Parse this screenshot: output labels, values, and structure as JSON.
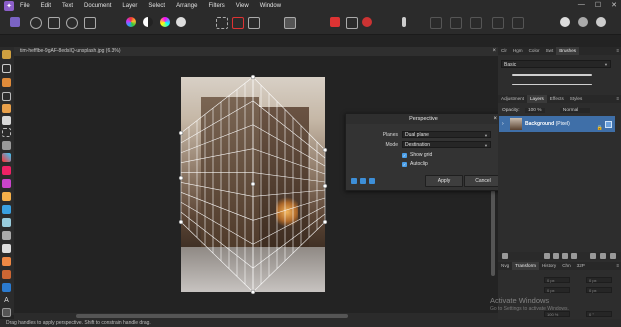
{
  "app": {
    "menus": [
      "File",
      "Edit",
      "Text",
      "Document",
      "Layer",
      "Select",
      "Arrange",
      "Filters",
      "View",
      "Window"
    ],
    "window_buttons": [
      "—",
      "☐",
      "✕"
    ]
  },
  "document": {
    "tab_title": "tim-hefflbe-9gAF-8edsIQ-unsplash.jpg (6.3%)"
  },
  "dialog": {
    "title": "Perspective",
    "planes_label": "Planes",
    "planes_value": "Dual plane",
    "mode_label": "Mode",
    "mode_value": "Destination",
    "show_grid_label": "Show grid",
    "show_grid_checked": true,
    "autoclip_label": "Autoclip",
    "autoclip_checked": true,
    "apply_label": "Apply",
    "cancel_label": "Cancel"
  },
  "right_panel": {
    "top_tabs": [
      "Clr",
      "Hgm",
      "Color",
      "Swt",
      "Brushes"
    ],
    "top_active": "Brushes",
    "brush_category": "Basic",
    "mid_tabs": [
      "Adjustment",
      "Layers",
      "Effects",
      "Styles"
    ],
    "mid_active": "Layers",
    "opacity_label": "Opacity:",
    "opacity_value": "100 %",
    "blend_mode": "Normal",
    "layer_name": "Background",
    "layer_type": "(Pixel)",
    "bottom_tabs": [
      "Nvg",
      "Transform",
      "History",
      "Chn",
      "32P"
    ],
    "bottom_active": "Transform",
    "transform_fields": [
      "0 px",
      "0 px",
      "0 px",
      "0 px",
      "100 %",
      "0 °"
    ]
  },
  "status_bar": {
    "text": "Drag handles to apply perspective. Shift to constrain handle drag."
  },
  "watermark": {
    "line1": "Activate Windows",
    "line2": "Go to Settings to activate Windows."
  },
  "colors": {
    "accent": "#4a9ee8",
    "layer_selected": "#3f6fa8",
    "grid": "#ffffff"
  }
}
